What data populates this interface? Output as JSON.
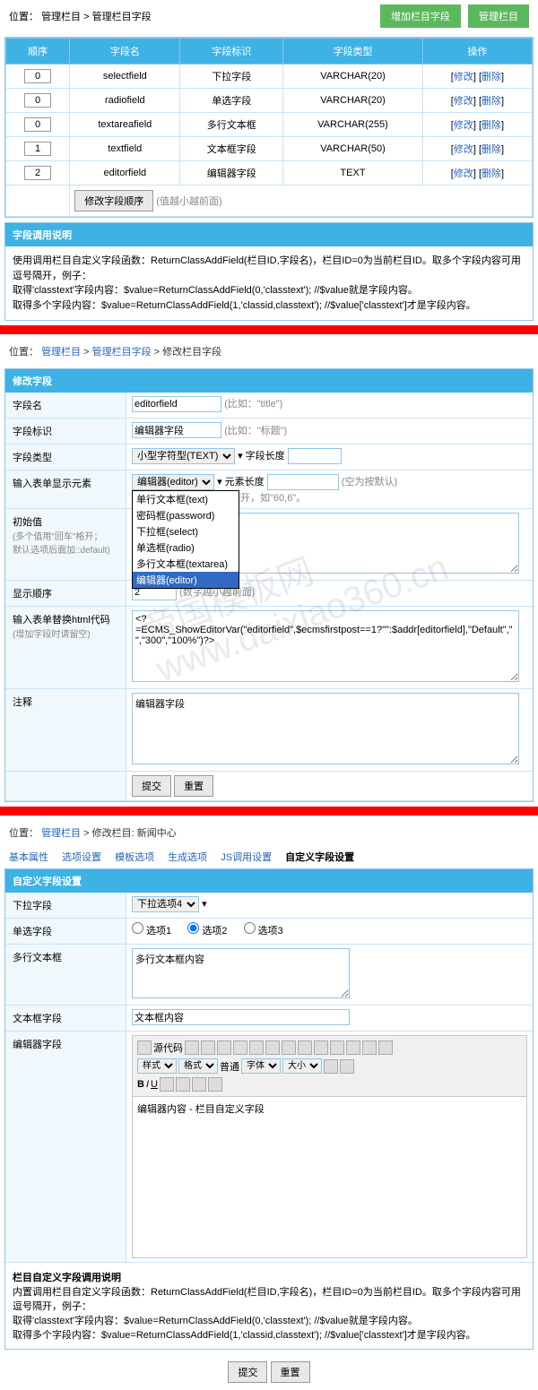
{
  "breadcrumb1": {
    "loc": "位置：",
    "l1": "管理栏目",
    "sep": " > ",
    "l2": "管理栏目字段"
  },
  "btns": {
    "add": "增加栏目字段",
    "manage": "管理栏目"
  },
  "grid": {
    "headers": [
      "顺序",
      "字段名",
      "字段标识",
      "字段类型",
      "操作"
    ],
    "rows": [
      {
        "order": "0",
        "name": "selectfield",
        "label": "下拉字段",
        "type": "VARCHAR(20)"
      },
      {
        "order": "0",
        "name": "radiofield",
        "label": "单选字段",
        "type": "VARCHAR(20)"
      },
      {
        "order": "0",
        "name": "textareafield",
        "label": "多行文本框",
        "type": "VARCHAR(255)"
      },
      {
        "order": "1",
        "name": "textfield",
        "label": "文本框字段",
        "type": "VARCHAR(50)"
      },
      {
        "order": "2",
        "name": "editorfield",
        "label": "编辑器字段",
        "type": "TEXT"
      }
    ],
    "modify": "修改",
    "delete": "删除",
    "orderBtn": "修改字段顺序",
    "orderHint": "(值越小越前面)"
  },
  "help1": {
    "title": "字段调用说明",
    "l1": "使用调用栏目自定义字段函数：ReturnClassAddField(栏目ID,字段名)，栏目ID=0为当前栏目ID。取多个字段内容可用逗号隔开，例子：",
    "l2": "取得'classtext'字段内容：$value=ReturnClassAddField(0,'classtext'); //$value就是字段内容。",
    "l3": "取得多个字段内容：$value=ReturnClassAddField(1,'classid,classtext'); //$value['classtext']才是字段内容。"
  },
  "breadcrumb2": {
    "loc": "位置：",
    "l1": "管理栏目",
    "l2": "管理栏目字段",
    "l3": "修改栏目字段"
  },
  "form": {
    "title": "修改字段",
    "fieldName": {
      "label": "字段名",
      "value": "editorfield",
      "hint": "(比如：\"title\")"
    },
    "fieldLabel": {
      "label": "字段标识",
      "value": "编辑器字段",
      "hint": "(比如：\"标题\")"
    },
    "fieldType": {
      "label": "字段类型",
      "value": "小型字符型(TEXT)",
      "len": "字段长度"
    },
    "element": {
      "label": "输入表单显示元素",
      "value": "编辑器(editor)",
      "lenLabel": "元素长度",
      "lenHint": "(空为按默认)",
      "hint": "框，长度与行数用逗号格开，如\"60,6\"。"
    },
    "dropdown": [
      "单行文本框(text)",
      "密码框(password)",
      "下拉框(select)",
      "单选框(radio)",
      "多行文本框(textarea)",
      "编辑器(editor)"
    ],
    "initial": {
      "label": "初始值",
      "hint1": "(多个值用\"回车\"格开；",
      "hint2": "默认选项后面加::default)"
    },
    "order": {
      "label": "显示顺序",
      "value": "2",
      "hint": "(数字越小越前面)"
    },
    "html": {
      "label": "输入表单替换html代码",
      "hint": "(增加字段时请留空)",
      "value": "<?=ECMS_ShowEditorVar(\"editorfield\",$ecmsfirstpost==1?\"\":$addr[editorfield],\"Default\",\"\",\"300\",\"100%\")?>"
    },
    "note": {
      "label": "注释",
      "value": "编辑器字段"
    },
    "submit": "提交",
    "reset": "重置"
  },
  "breadcrumb3": {
    "loc": "位置：",
    "l1": "管理栏目",
    "l2": "修改栏目: 新闻中心"
  },
  "tabs": [
    "基本属性",
    "选项设置",
    "模板选项",
    "生成选项",
    "JS调用设置",
    "自定义字段设置"
  ],
  "form2": {
    "title": "自定义字段设置",
    "dropdown": {
      "label": "下拉字段",
      "value": "下拉选项4"
    },
    "radio": {
      "label": "单选字段",
      "opts": [
        "选项1",
        "选项2",
        "选项3"
      ]
    },
    "textarea": {
      "label": "多行文本框",
      "value": "多行文本框内容"
    },
    "textbox": {
      "label": "文本框字段",
      "value": "文本框内容"
    },
    "editor": {
      "label": "编辑器字段",
      "source": "源代码",
      "style": "样式",
      "format": "格式",
      "font": "字体",
      "size": "大小",
      "normal": "普通",
      "content": "编辑器内容 - 栏目自定义字段"
    }
  },
  "help2": {
    "title": "栏目自定义字段调用说明",
    "l1": "内置调用栏目自定义字段函数：ReturnClassAddField(栏目ID,字段名)，栏目ID=0为当前栏目ID。取多个字段内容可用逗号隔开，例子：",
    "l2": "取得'classtext'字段内容：$value=ReturnClassAddField(0,'classtext'); //$value就是字段内容。",
    "l3": "取得多个字段内容：$value=ReturnClassAddField(1,'classid,classtext'); //$value['classtext']才是字段内容。"
  }
}
